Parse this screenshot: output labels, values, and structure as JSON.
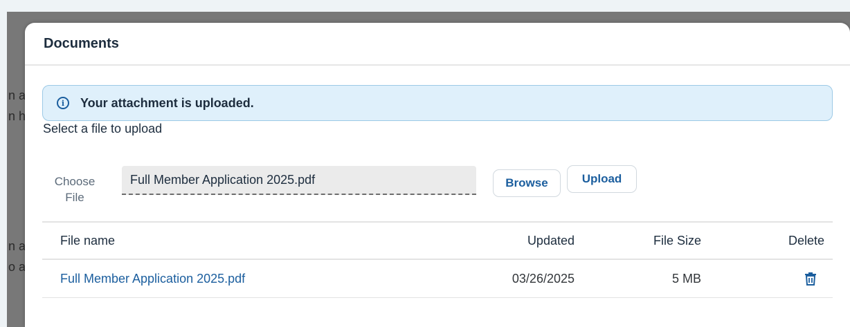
{
  "background": {
    "fragments": [
      "n a",
      "n h",
      "n a",
      "o a"
    ]
  },
  "dialog": {
    "title": "Documents"
  },
  "message": {
    "icon": "info-icon",
    "text": "Your attachment is uploaded."
  },
  "upload": {
    "prompt": "Select a file to upload",
    "choose_label": "Choose File",
    "file_value": "Full Member Application 2025.pdf",
    "browse_label": "Browse",
    "upload_label": "Upload"
  },
  "table": {
    "columns": {
      "name": "File name",
      "updated": "Updated",
      "size": "File Size",
      "delete": "Delete"
    },
    "rows": [
      {
        "name": "Full Member Application 2025.pdf",
        "updated": "03/26/2025",
        "size": "5 MB",
        "delete_icon": "trash-icon"
      }
    ]
  },
  "colors": {
    "accent": "#1b5e9e",
    "info_bg": "#dff0fb",
    "info_border": "#9cc9e6",
    "overlay": "#787878"
  }
}
